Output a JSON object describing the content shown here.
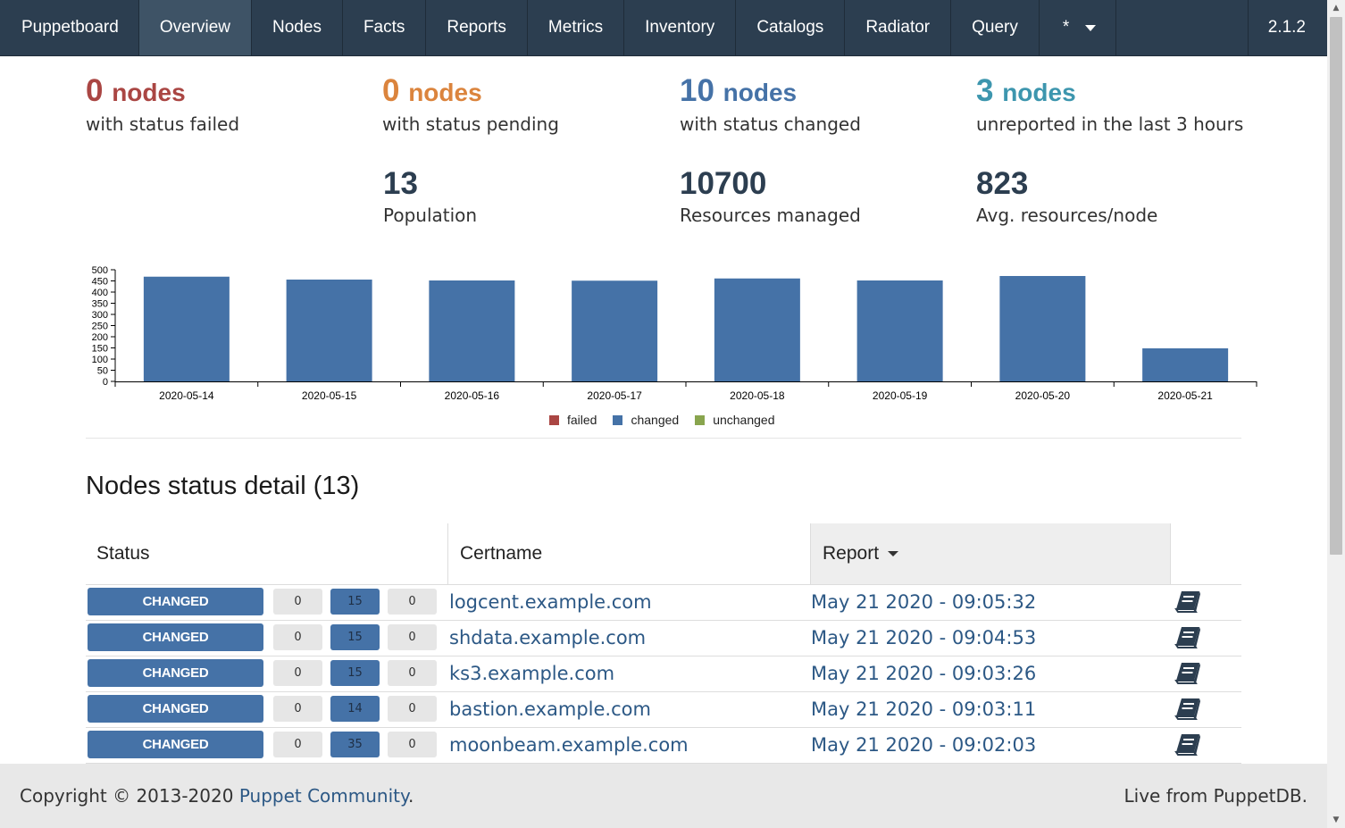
{
  "navbar": {
    "brand": "Puppetboard",
    "items": [
      "Overview",
      "Nodes",
      "Facts",
      "Reports",
      "Metrics",
      "Inventory",
      "Catalogs",
      "Radiator",
      "Query"
    ],
    "more": "*",
    "version": "2.1.2"
  },
  "stats": {
    "failed": {
      "count": "0",
      "unit": "nodes",
      "label": "with status failed"
    },
    "pending": {
      "count": "0",
      "unit": "nodes",
      "label": "with status pending"
    },
    "changed": {
      "count": "10",
      "unit": "nodes",
      "label": "with status changed"
    },
    "unreported": {
      "count": "3",
      "unit": "nodes",
      "label": "unreported in the last 3 hours"
    },
    "population": {
      "value": "13",
      "label": "Population"
    },
    "resources": {
      "value": "10700",
      "label": "Resources managed"
    },
    "avg": {
      "value": "823",
      "label": "Avg. resources/node"
    }
  },
  "chart_data": {
    "type": "bar",
    "categories": [
      "2020-05-14",
      "2020-05-15",
      "2020-05-16",
      "2020-05-17",
      "2020-05-18",
      "2020-05-19",
      "2020-05-20",
      "2020-05-21"
    ],
    "series": [
      {
        "name": "failed",
        "color": "#aa4643",
        "values": [
          0,
          0,
          0,
          0,
          0,
          0,
          0,
          0
        ]
      },
      {
        "name": "changed",
        "color": "#4572a7",
        "values": [
          469,
          456,
          452,
          451,
          461,
          452,
          472,
          148
        ]
      },
      {
        "name": "unchanged",
        "color": "#89a54e",
        "values": [
          0,
          0,
          0,
          0,
          0,
          0,
          0,
          0
        ]
      }
    ],
    "yticks": [
      0,
      50,
      100,
      150,
      200,
      250,
      300,
      350,
      400,
      450,
      500
    ],
    "ylim": [
      0,
      500
    ],
    "legend": "bottom-center",
    "grid": false
  },
  "detail": {
    "title": "Nodes status detail (13)",
    "headers": {
      "status": "Status",
      "certname": "Certname",
      "report": "Report"
    },
    "rows": [
      {
        "status": "CHANGED",
        "failed": "0",
        "changed": "15",
        "unchanged": "0",
        "certname": "logcent.example.com",
        "report": "May 21 2020 - 09:05:32"
      },
      {
        "status": "CHANGED",
        "failed": "0",
        "changed": "15",
        "unchanged": "0",
        "certname": "shdata.example.com",
        "report": "May 21 2020 - 09:04:53"
      },
      {
        "status": "CHANGED",
        "failed": "0",
        "changed": "15",
        "unchanged": "0",
        "certname": "ks3.example.com",
        "report": "May 21 2020 - 09:03:26"
      },
      {
        "status": "CHANGED",
        "failed": "0",
        "changed": "14",
        "unchanged": "0",
        "certname": "bastion.example.com",
        "report": "May 21 2020 - 09:03:11"
      },
      {
        "status": "CHANGED",
        "failed": "0",
        "changed": "35",
        "unchanged": "0",
        "certname": "moonbeam.example.com",
        "report": "May 21 2020 - 09:02:03"
      }
    ]
  },
  "footer": {
    "copyright": "Copyright © 2013-2020 ",
    "link": "Puppet Community",
    "period": ".",
    "right": "Live from PuppetDB."
  }
}
